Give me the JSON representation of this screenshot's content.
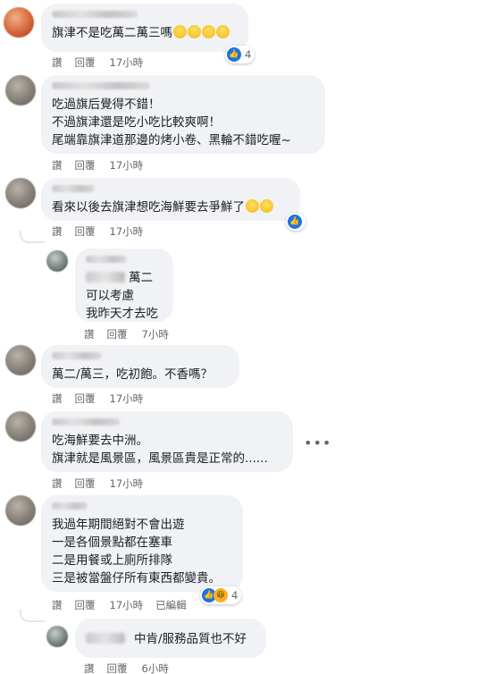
{
  "actions": {
    "like": "讚",
    "reply": "回覆",
    "edited": "已編輯"
  },
  "comments": [
    {
      "lines": [
        "旗津不是吃萬二萬三嗎"
      ],
      "time": "17小時",
      "reactions": "4"
    },
    {
      "lines": [
        "吃過旗后覺得不錯！",
        "不過旗津還是吃小吃比較爽啊！",
        "尾端靠旗津道那邊的烤小卷、黑輪不錯吃喔~"
      ],
      "time": "17小時"
    },
    {
      "lines": [
        "看來以後去旗津想吃海鮮要去爭鮮了"
      ],
      "time": "17小時"
    },
    {
      "lines": [
        "萬二",
        "可以考慮",
        "我昨天才去吃"
      ],
      "time": "7小時"
    },
    {
      "lines": [
        "萬二/萬三，吃初飽。不香嗎？"
      ],
      "time": "17小時"
    },
    {
      "lines": [
        "吃海鮮要去中洲。",
        "旗津就是風景區，風景區貴是正常的......"
      ],
      "time": "17小時"
    },
    {
      "lines": [
        "我過年期間絕對不會出遊",
        "一是各個景點都在塞車",
        "二是用餐或上廁所排隊",
        "三是被當盤仔所有東西都變貴。"
      ],
      "time": "17小時",
      "reactions": "4"
    },
    {
      "lines": [
        "中肯/服務品質也不好"
      ],
      "time": "6小時"
    }
  ]
}
